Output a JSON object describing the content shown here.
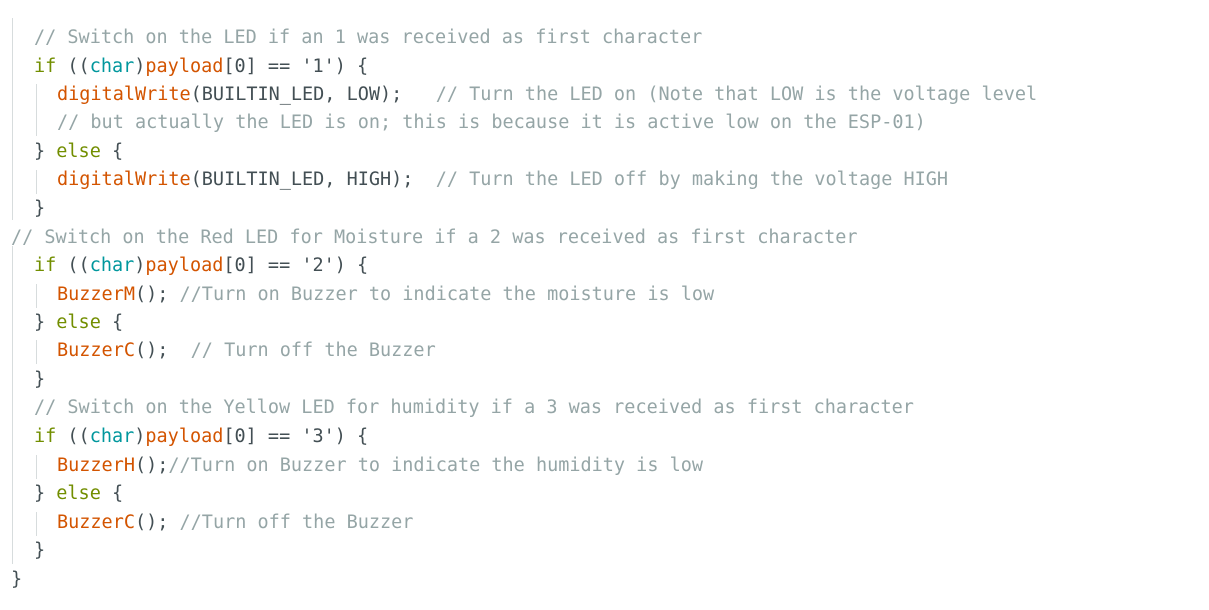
{
  "editor": {
    "colors": {
      "keyword": "#728e00",
      "type": "#00979d",
      "function": "#d35400",
      "comment": "#95a5a6",
      "text": "#434f54",
      "indent_guide": "#d7dcdd",
      "background": "#ffffff"
    },
    "lines": [
      {
        "role": "comment",
        "tokens": [
          {
            "t": "// Switch on the LED if an 1 was received as first character",
            "c": "comment"
          }
        ]
      },
      {
        "role": "if-statement",
        "tokens": [
          {
            "t": "if",
            "c": "keyword"
          },
          {
            "t": " ((",
            "c": "plain"
          },
          {
            "t": "char",
            "c": "type"
          },
          {
            "t": ")",
            "c": "plain"
          },
          {
            "t": "payload",
            "c": "func"
          },
          {
            "t": "[0] == '1') {",
            "c": "plain"
          }
        ]
      },
      {
        "role": "call-statement",
        "tokens": [
          {
            "t": "digitalWrite",
            "c": "func"
          },
          {
            "t": "(BUILTIN_LED, LOW);   ",
            "c": "plain"
          },
          {
            "t": "// Turn the LED on (Note that LOW is the voltage level",
            "c": "comment"
          }
        ]
      },
      {
        "role": "comment",
        "tokens": [
          {
            "t": "// but actually the LED is on; this is because it is active low on the ESP-01)",
            "c": "comment"
          }
        ]
      },
      {
        "role": "else-statement",
        "tokens": [
          {
            "t": "} ",
            "c": "plain"
          },
          {
            "t": "else",
            "c": "keyword"
          },
          {
            "t": " {",
            "c": "plain"
          }
        ]
      },
      {
        "role": "call-statement",
        "tokens": [
          {
            "t": "digitalWrite",
            "c": "func"
          },
          {
            "t": "(BUILTIN_LED, HIGH);  ",
            "c": "plain"
          },
          {
            "t": "// Turn the LED off by making the voltage HIGH",
            "c": "comment"
          }
        ]
      },
      {
        "role": "closing-brace",
        "tokens": [
          {
            "t": "}",
            "c": "plain"
          }
        ]
      },
      {
        "role": "comment",
        "tokens": [
          {
            "t": "// Switch on the Red LED for Moisture if a 2 was received as first character",
            "c": "comment"
          }
        ]
      },
      {
        "role": "if-statement",
        "tokens": [
          {
            "t": "if",
            "c": "keyword"
          },
          {
            "t": " ((",
            "c": "plain"
          },
          {
            "t": "char",
            "c": "type"
          },
          {
            "t": ")",
            "c": "plain"
          },
          {
            "t": "payload",
            "c": "func"
          },
          {
            "t": "[0] == '2') {",
            "c": "plain"
          }
        ]
      },
      {
        "role": "call-statement",
        "tokens": [
          {
            "t": "BuzzerM",
            "c": "func"
          },
          {
            "t": "(); ",
            "c": "plain"
          },
          {
            "t": "//Turn on Buzzer to indicate the moisture is low",
            "c": "comment"
          }
        ]
      },
      {
        "role": "else-statement",
        "tokens": [
          {
            "t": "} ",
            "c": "plain"
          },
          {
            "t": "else",
            "c": "keyword"
          },
          {
            "t": " {",
            "c": "plain"
          }
        ]
      },
      {
        "role": "call-statement",
        "tokens": [
          {
            "t": "BuzzerC",
            "c": "func"
          },
          {
            "t": "();  ",
            "c": "plain"
          },
          {
            "t": "// Turn off the Buzzer",
            "c": "comment"
          }
        ]
      },
      {
        "role": "closing-brace",
        "tokens": [
          {
            "t": "}",
            "c": "plain"
          }
        ]
      },
      {
        "role": "comment",
        "tokens": [
          {
            "t": "// Switch on the Yellow LED for humidity if a 3 was received as first character",
            "c": "comment"
          }
        ]
      },
      {
        "role": "if-statement",
        "tokens": [
          {
            "t": "if",
            "c": "keyword"
          },
          {
            "t": " ((",
            "c": "plain"
          },
          {
            "t": "char",
            "c": "type"
          },
          {
            "t": ")",
            "c": "plain"
          },
          {
            "t": "payload",
            "c": "func"
          },
          {
            "t": "[0] == '3') {",
            "c": "plain"
          }
        ]
      },
      {
        "role": "call-statement",
        "tokens": [
          {
            "t": "BuzzerH",
            "c": "func"
          },
          {
            "t": "();",
            "c": "plain"
          },
          {
            "t": "//Turn on Buzzer to indicate the humidity is low",
            "c": "comment"
          }
        ]
      },
      {
        "role": "else-statement",
        "tokens": [
          {
            "t": "} ",
            "c": "plain"
          },
          {
            "t": "else",
            "c": "keyword"
          },
          {
            "t": " {",
            "c": "plain"
          }
        ]
      },
      {
        "role": "call-statement",
        "tokens": [
          {
            "t": "BuzzerC",
            "c": "func"
          },
          {
            "t": "(); ",
            "c": "plain"
          },
          {
            "t": "//Turn off the Buzzer",
            "c": "comment"
          }
        ]
      },
      {
        "role": "closing-brace",
        "tokens": [
          {
            "t": "}",
            "c": "plain"
          }
        ]
      },
      {
        "role": "closing-brace",
        "tokens": [
          {
            "t": "}",
            "c": "plain"
          }
        ]
      }
    ]
  }
}
